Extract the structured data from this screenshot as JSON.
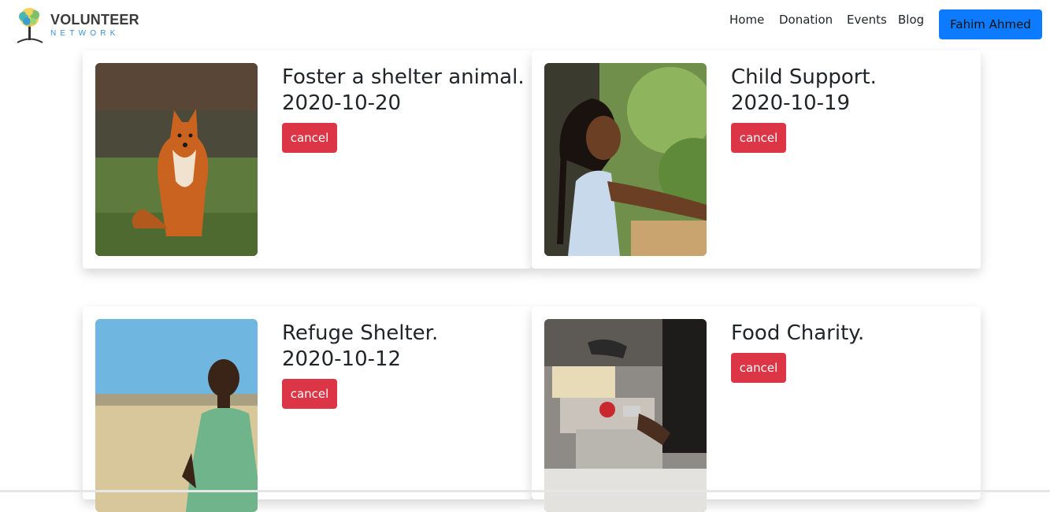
{
  "brand": {
    "title": "VOLUNTEER",
    "subtitle": "NETWORK",
    "logo_icon": "tree-logo-icon"
  },
  "nav": {
    "home": "Home",
    "donation": "Donation",
    "events": "Events",
    "blog": "Blog"
  },
  "user": {
    "name": "Fahim Ahmed"
  },
  "colors": {
    "primary": "#0d7bff",
    "danger": "#dc3545"
  },
  "events": [
    {
      "title": "Foster a shelter animal.",
      "date": "2020-10-20",
      "cancel_label": "cancel",
      "image": "fox-photo"
    },
    {
      "title": "Child Support.",
      "date": "2020-10-19",
      "cancel_label": "cancel",
      "image": "smiling-girl-photo"
    },
    {
      "title": "Refuge Shelter.",
      "date": "2020-10-12",
      "cancel_label": "cancel",
      "image": "boy-in-field-photo"
    },
    {
      "title": "Food Charity.",
      "date": "",
      "cancel_label": "cancel",
      "image": "food-donation-photo"
    }
  ]
}
